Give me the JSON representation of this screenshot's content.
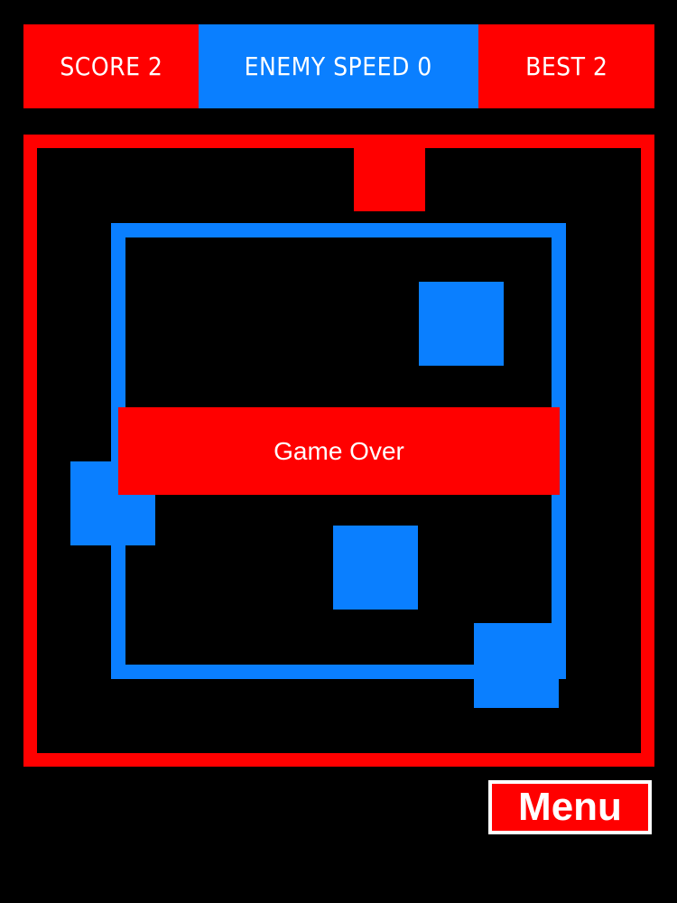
{
  "colors": {
    "red": "#ff0000",
    "blue": "#0a7fff",
    "background": "#000000",
    "text": "#ffffff"
  },
  "hud": {
    "score_label": "SCORE 2",
    "enemy_speed_label": "ENEMY SPEED 0",
    "best_label": "BEST 2"
  },
  "game": {
    "score": 2,
    "enemy_speed": 0,
    "best": 2,
    "status": "Game Over"
  },
  "menu": {
    "label": "Menu"
  }
}
